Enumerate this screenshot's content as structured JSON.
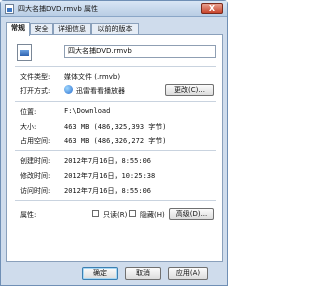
{
  "window": {
    "title": "四大名捕DVD.rmvb 属性",
    "close_label": "X"
  },
  "tabs": [
    {
      "label": "常规"
    },
    {
      "label": "安全"
    },
    {
      "label": "详细信息"
    },
    {
      "label": "以前的版本"
    }
  ],
  "general": {
    "file_name": "四大名捕DVD.rmvb",
    "file_type_label": "文件类型:",
    "file_type_value": "媒体文件 (.rmvb)",
    "open_with_label": "打开方式:",
    "open_with_value": "迅雷看看播放器",
    "change_button": "更改(C)...",
    "location_label": "位置:",
    "location_value": "F:\\Download",
    "size_label": "大小:",
    "size_value": "463 MB (486,325,393 字节)",
    "size_on_disk_label": "占用空间:",
    "size_on_disk_value": "463 MB (486,326,272 字节)",
    "created_label": "创建时间:",
    "created_value": "2012年7月16日，8:55:06",
    "modified_label": "修改时间:",
    "modified_value": "2012年7月16日，10:25:38",
    "accessed_label": "访问时间:",
    "accessed_value": "2012年7月16日，8:55:06",
    "attributes_label": "属性:",
    "readonly_label": "只读(R)",
    "hidden_label": "隐藏(H)",
    "advanced_button": "高级(D)..."
  },
  "footer": {
    "ok": "确定",
    "cancel": "取消",
    "apply": "应用(A)"
  }
}
